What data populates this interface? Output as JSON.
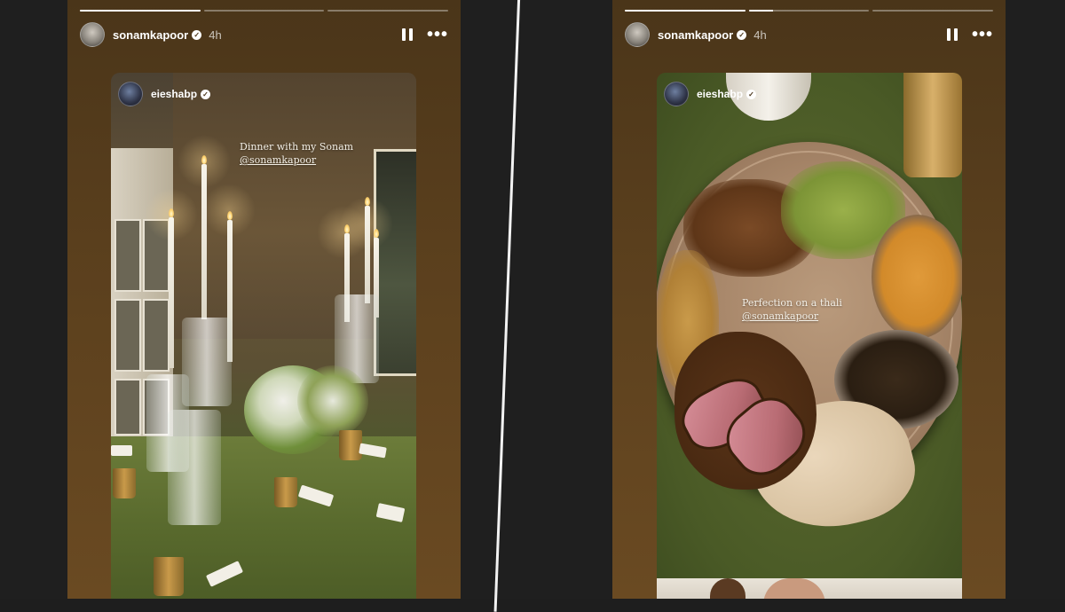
{
  "stories": [
    {
      "username": "sonamkapoor",
      "time": "4h",
      "progress": [
        1.0,
        0.0,
        0.0
      ],
      "inner": {
        "username": "eieshabp",
        "caption_line1": "Dinner with my Sonam",
        "caption_mention": "@sonamkapoor"
      }
    },
    {
      "username": "sonamkapoor",
      "time": "4h",
      "progress": [
        1.0,
        0.2,
        0.0
      ],
      "inner": {
        "username": "eieshabp",
        "caption_line1": "Perfection on a thali",
        "caption_mention": "@sonamkapoor"
      }
    }
  ],
  "icons": {
    "verified": "verified-badge-icon",
    "pause": "pause-icon",
    "more": "more-options-icon"
  },
  "colors": {
    "story_bg": "#4a3519",
    "divider": "#f2f2f2"
  }
}
